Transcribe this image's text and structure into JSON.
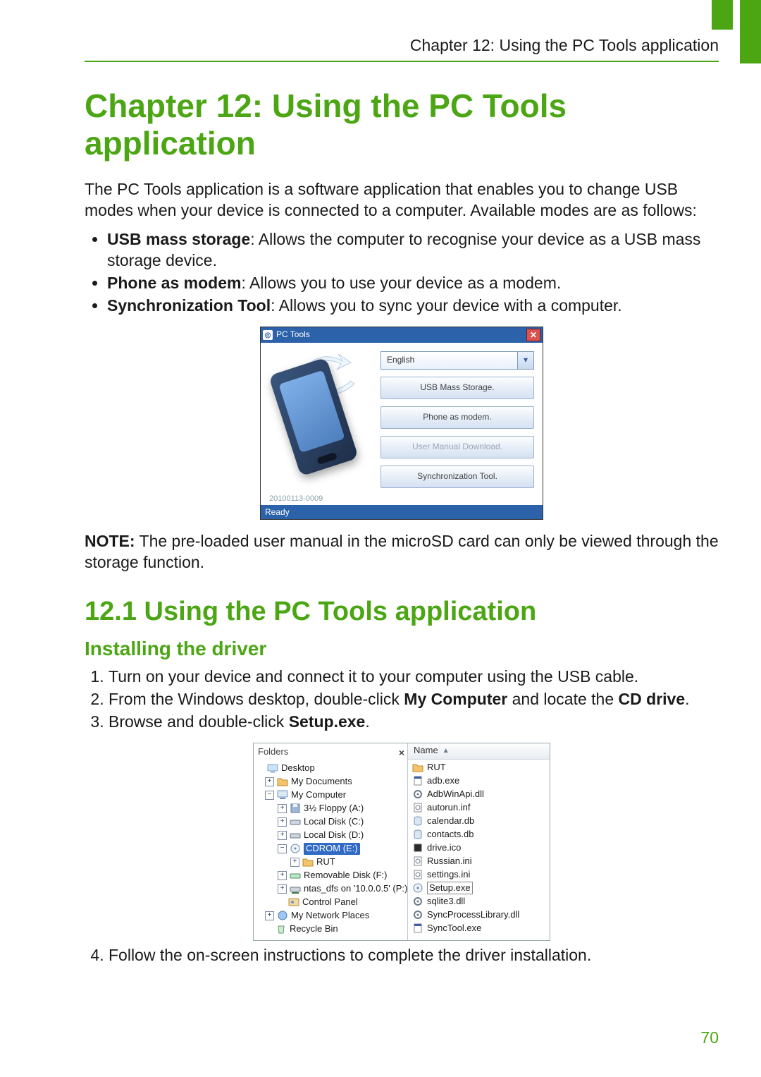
{
  "header": {
    "running_head": "Chapter 12: Using the PC Tools application"
  },
  "chapter_title": "Chapter 12: Using the PC Tools application",
  "intro": "The PC Tools application is a software application that enables you to change USB modes when your device is connected to a computer. Available modes are as follows:",
  "modes": [
    {
      "name": "USB mass storage",
      "desc": ": Allows the computer to recognise your device as a USB mass storage device."
    },
    {
      "name": "Phone as modem",
      "desc": ": Allows you to use your device as a modem."
    },
    {
      "name": "Synchronization Tool",
      "desc": ": Allows you to sync your device with a computer."
    }
  ],
  "pctools": {
    "title": "PC Tools",
    "language": "English",
    "buttons": {
      "usb": "USB Mass Storage.",
      "modem": "Phone as modem.",
      "manual": "User Manual Download.",
      "sync": "Synchronization Tool."
    },
    "build": "20100113-0009",
    "status": "Ready"
  },
  "note_label": "NOTE:",
  "note_text": " The pre-loaded user manual in the microSD card can only be viewed through the storage function.",
  "section_title": "12.1 Using the PC Tools application",
  "subheading": "Installing the driver",
  "steps": {
    "s1": "Turn on your device and connect it to your computer using the USB cable.",
    "s2a": "From the Windows desktop, double-click ",
    "s2b": "My Computer",
    "s2c": " and locate the ",
    "s2d": "CD drive",
    "s2e": ".",
    "s3a": "Browse and double-click ",
    "s3b": "Setup.exe",
    "s3c": ".",
    "s4": "Follow the on-screen instructions to complete the driver installation."
  },
  "explorer": {
    "folders_title": "Folders",
    "tree": {
      "desktop": "Desktop",
      "mydocs": "My Documents",
      "mycomp": "My Computer",
      "floppy": "3½ Floppy (A:)",
      "c": "Local Disk (C:)",
      "d": "Local Disk (D:)",
      "cdrom": "CDROM (E:)",
      "rut": "RUT",
      "removable": "Removable Disk (F:)",
      "netdrive": "ntas_dfs on '10.0.0.5' (P:)",
      "cpanel": "Control Panel",
      "netplaces": "My Network Places",
      "recycle": "Recycle Bin"
    },
    "col_name": "Name",
    "files": [
      "RUT",
      "adb.exe",
      "AdbWinApi.dll",
      "autorun.inf",
      "calendar.db",
      "contacts.db",
      "drive.ico",
      "Russian.ini",
      "settings.ini",
      "Setup.exe",
      "sqlite3.dll",
      "SyncProcessLibrary.dll",
      "SyncTool.exe"
    ],
    "selected_file": "Setup.exe"
  },
  "page_number": "70"
}
